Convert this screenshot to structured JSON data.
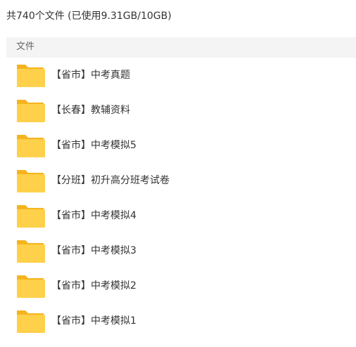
{
  "summary": "共740个文件 (已使用9.31GB/10GB)",
  "column_header": "文件",
  "colors": {
    "folder_body": "#FFD04A",
    "folder_tab": "#F5B41E",
    "header_bg": "#F4F4F5"
  },
  "files": [
    {
      "name": "【省市】中考真题",
      "icon": "folder-icon"
    },
    {
      "name": "【长春】教辅资料",
      "icon": "folder-icon"
    },
    {
      "name": "【省市】中考模拟5",
      "icon": "folder-icon"
    },
    {
      "name": "【分班】初升高分班考试卷",
      "icon": "folder-icon"
    },
    {
      "name": "【省市】中考模拟4",
      "icon": "folder-icon"
    },
    {
      "name": "【省市】中考模拟3",
      "icon": "folder-icon"
    },
    {
      "name": "【省市】中考模拟2",
      "icon": "folder-icon"
    },
    {
      "name": "【省市】中考模拟1",
      "icon": "folder-icon"
    }
  ]
}
